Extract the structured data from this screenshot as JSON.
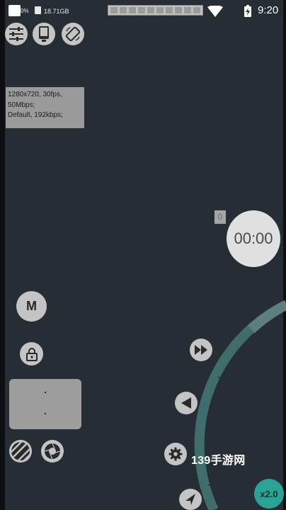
{
  "status_bar": {
    "battery_percent": "0%",
    "storage": "18.71GB",
    "time": "9:20",
    "icons": [
      "sd-card-icon",
      "memory-meter-icon",
      "wifi-icon",
      "battery-charging-icon"
    ]
  },
  "toolbar": {
    "icons": [
      "sliders-icon",
      "device-icon",
      "rotate-screen-icon"
    ]
  },
  "settings_info": {
    "line1": "1280x720, 30fps,",
    "line2": "50Mbps;",
    "line3": "Default, 192kbps;"
  },
  "record": {
    "count": "0",
    "timer": "00:00"
  },
  "controls": {
    "macro_label": "M",
    "icons": [
      "lock-icon",
      "fast-forward-icon",
      "speaker-icon",
      "gear-icon",
      "arrow-icon",
      "stripes-icon",
      "aperture-icon"
    ]
  },
  "speed": {
    "label": "x2.0"
  },
  "watermark": {
    "text": "139手游网"
  },
  "colors": {
    "background": "#272d35",
    "button_gray": "#c4c4c4",
    "accent_teal": "#2aa296",
    "arc_teal": "#3f6d6c"
  }
}
